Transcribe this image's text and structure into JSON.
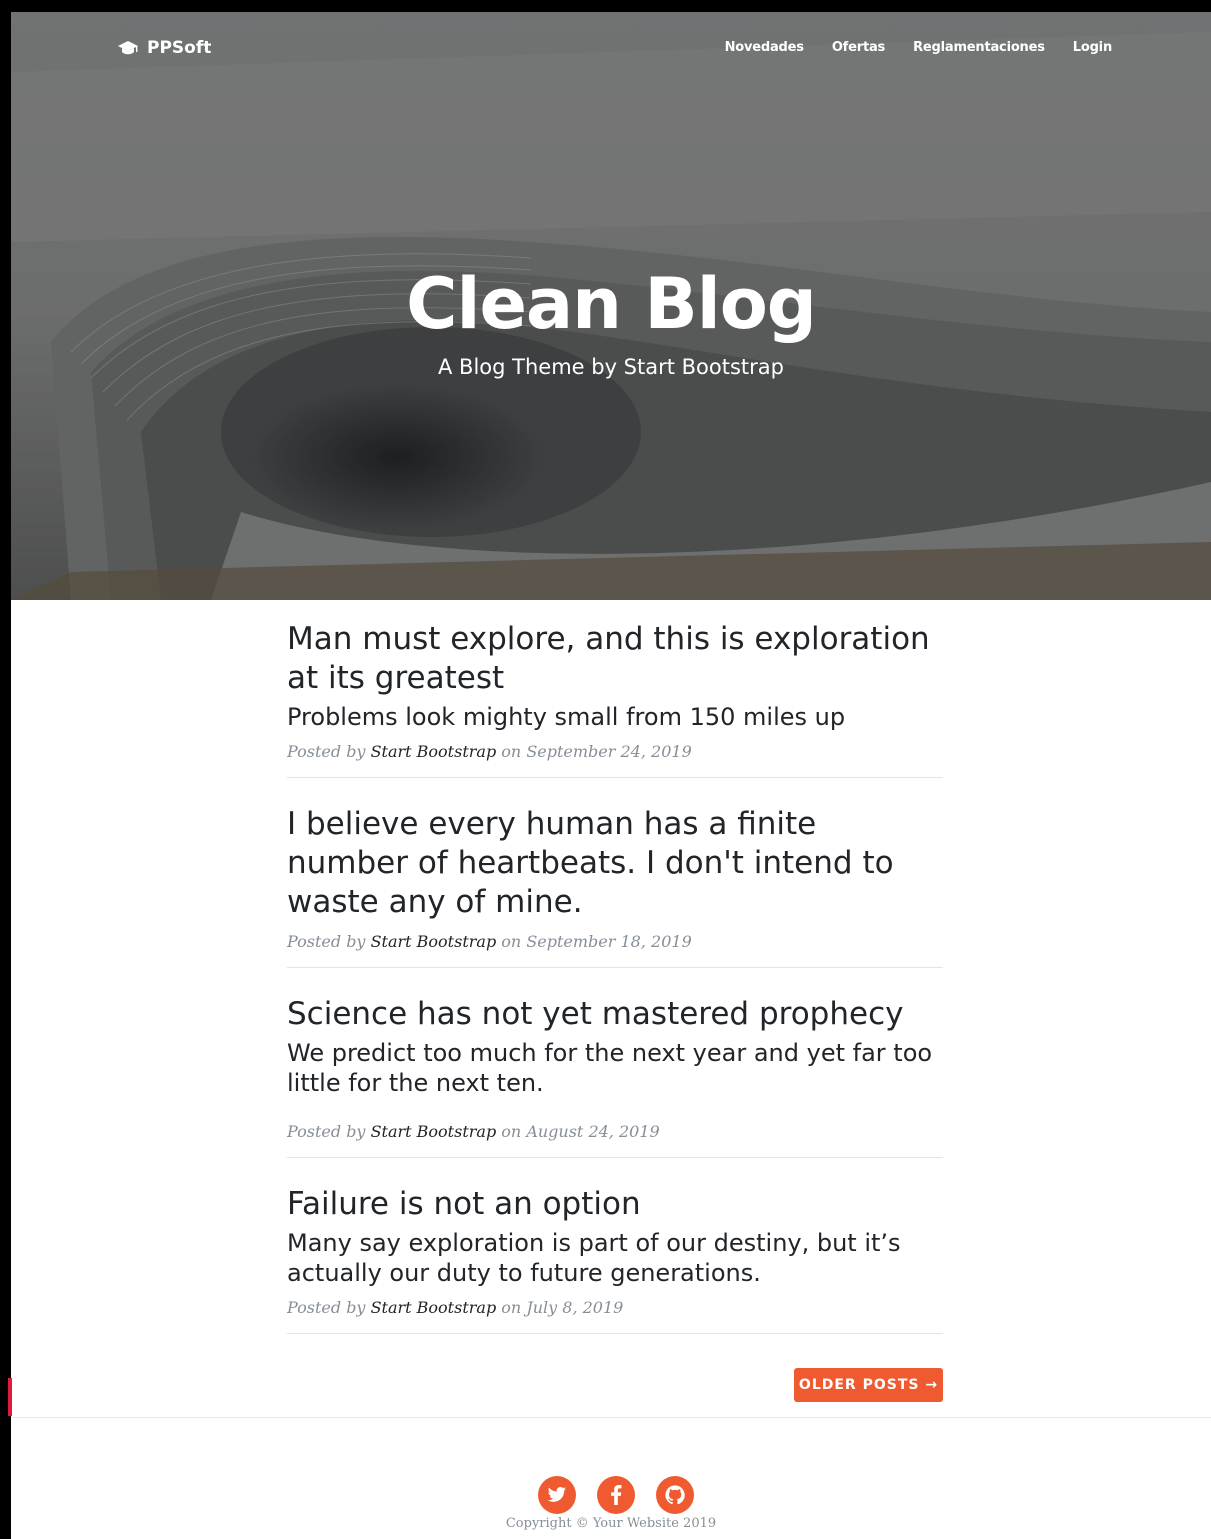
{
  "nav": {
    "brand": "PPSoft",
    "links": [
      "Novedades",
      "Ofertas",
      "Reglamentaciones",
      "Login"
    ]
  },
  "hero": {
    "title": "Clean Blog",
    "subtitle": "A Blog Theme by Start Bootstrap"
  },
  "posts": [
    {
      "title": "Man must explore, and this is exploration at its greatest",
      "subtitle": "Problems look mighty small from 150 miles up",
      "meta_prefix": "Posted by",
      "author": "Start Bootstrap",
      "meta_on": "on",
      "date": "September 24, 2019"
    },
    {
      "title": "I believe every human has a finite number of heartbeats. I don't intend to waste any of mine.",
      "subtitle": "",
      "meta_prefix": "Posted by",
      "author": "Start Bootstrap",
      "meta_on": "on",
      "date": "September 18, 2019"
    },
    {
      "title": "Science has not yet mastered prophecy",
      "subtitle": "We predict too much for the next year and yet far too little for the next ten.",
      "meta_prefix": "Posted by",
      "author": "Start Bootstrap",
      "meta_on": "on",
      "date": "August 24, 2019"
    },
    {
      "title": "Failure is not an option",
      "subtitle": "Many say exploration is part of our destiny, but it’s actually our duty to future generations.",
      "meta_prefix": "Posted by",
      "author": "Start Bootstrap",
      "meta_on": "on",
      "date": "July 8, 2019"
    }
  ],
  "pager": {
    "older_label": "OLDER POSTS →"
  },
  "footer": {
    "social_icons": [
      "twitter-icon",
      "facebook-icon",
      "github-icon"
    ],
    "copyright": "Copyright © Your Website 2019"
  },
  "colors": {
    "accent": "#f05a30",
    "text": "#212529",
    "muted": "#868e96"
  }
}
